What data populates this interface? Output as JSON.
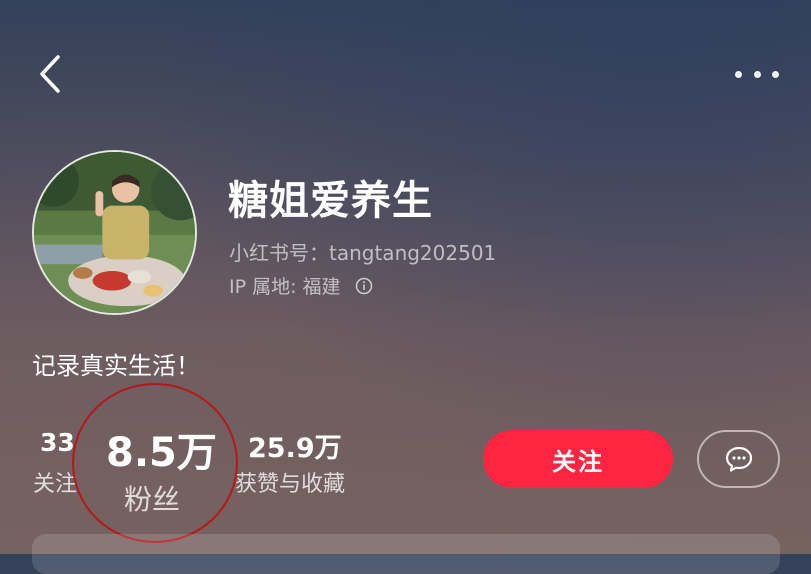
{
  "profile": {
    "name": "糖姐爱养生",
    "account_id": "小红书号：tangtang202501",
    "ip_location": "IP 属地: 福建",
    "bio": "记录真实生活！"
  },
  "stats": {
    "following_count": "33",
    "following_label": "关注",
    "fans_count": "8.5万",
    "fans_label": "粉丝",
    "likes_count": "25.9万",
    "likes_label": "获赞与收藏"
  },
  "actions": {
    "follow_label": "关注"
  },
  "icons": {
    "back": "chevron-left-icon",
    "more": "more-dots-icon",
    "info": "info-circle-icon",
    "chat": "chat-bubble-icon"
  },
  "colors": {
    "follow_button": "#ff2442",
    "highlight_circle": "#b8161b"
  }
}
